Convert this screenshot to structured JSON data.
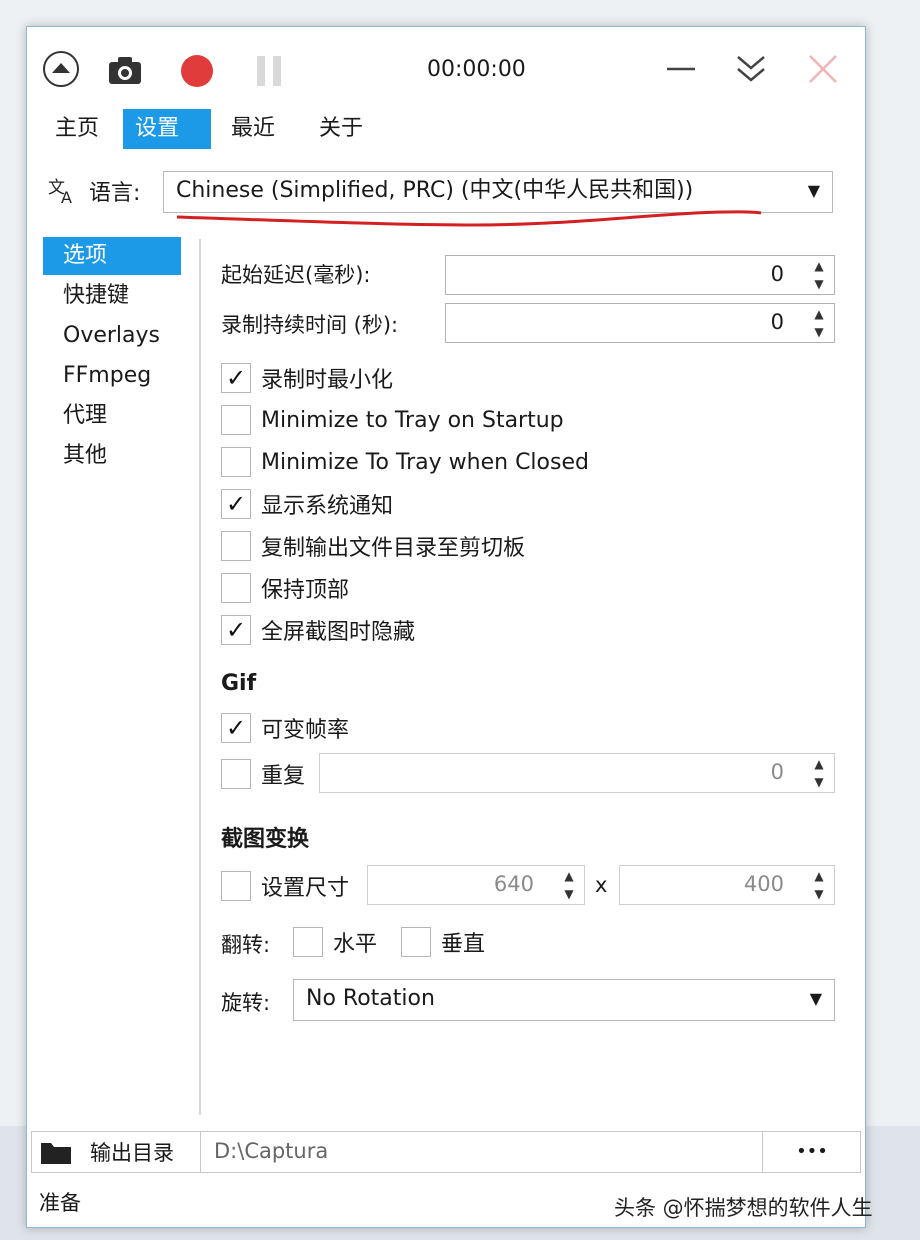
{
  "titlebar": {
    "timer": "00:00:00"
  },
  "tabs": [
    {
      "label": "主页",
      "active": false
    },
    {
      "label": "设置",
      "active": true
    },
    {
      "label": "最近",
      "active": false
    },
    {
      "label": "关于",
      "active": false
    }
  ],
  "language": {
    "label": "语言:",
    "value": "Chinese (Simplified, PRC) (中文(中华人民共和国))"
  },
  "nav": [
    {
      "label": "选项",
      "active": true
    },
    {
      "label": "快捷键",
      "active": false
    },
    {
      "label": "Overlays",
      "active": false
    },
    {
      "label": "FFmpeg",
      "active": false
    },
    {
      "label": "代理",
      "active": false
    },
    {
      "label": "其他",
      "active": false
    }
  ],
  "options": {
    "start_delay": {
      "label": "起始延迟(毫秒):",
      "value": "0"
    },
    "duration": {
      "label": "录制持续时间 (秒):",
      "value": "0"
    },
    "checkboxes": [
      {
        "label": "录制时最小化",
        "checked": true
      },
      {
        "label": "Minimize to Tray on Startup",
        "checked": false
      },
      {
        "label": "Minimize To Tray when Closed",
        "checked": false
      },
      {
        "label": "显示系统通知",
        "checked": true
      },
      {
        "label": "复制输出文件目录至剪切板",
        "checked": false
      },
      {
        "label": "保持顶部",
        "checked": false
      },
      {
        "label": "全屏截图时隐藏",
        "checked": true
      }
    ]
  },
  "gif": {
    "title": "Gif",
    "variable_framerate": {
      "label": "可变帧率",
      "checked": true
    },
    "repeat": {
      "label": "重复",
      "checked": false,
      "value": "0"
    }
  },
  "transform": {
    "title": "截图变换",
    "resize": {
      "label": "设置尺寸",
      "checked": false,
      "width": "640",
      "separator": "x",
      "height": "400"
    },
    "flip": {
      "label": "翻转:",
      "horizontal": "水平",
      "vertical": "垂直"
    },
    "rotate": {
      "label": "旋转:",
      "value": "No Rotation"
    }
  },
  "output": {
    "label": "输出目录",
    "path": "D:\\Captura",
    "more": "•••"
  },
  "status": "准备",
  "watermark": "头条 @怀揣梦想的软件人生",
  "colors": {
    "accent": "#1d9ae7",
    "record": "#e03c3c",
    "close": "#f2b3b3"
  }
}
